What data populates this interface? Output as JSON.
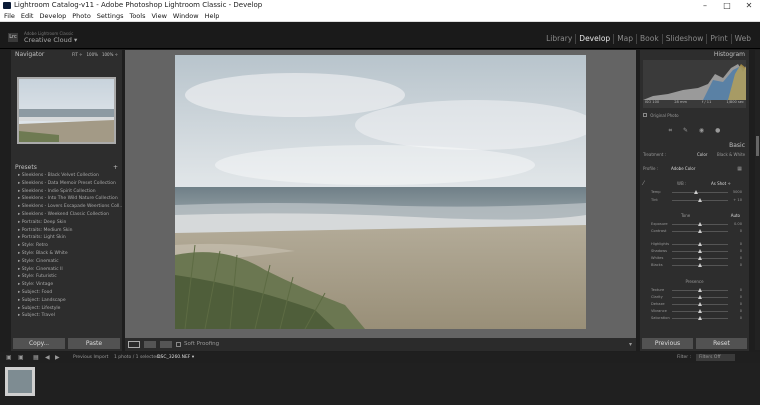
{
  "window": {
    "title": "Lightroom Catalog-v11 - Adobe Photoshop Lightroom Classic - Develop"
  },
  "menu": [
    "File",
    "Edit",
    "Develop",
    "Photo",
    "Settings",
    "Tools",
    "View",
    "Window",
    "Help"
  ],
  "identity": {
    "badge": "Lrc",
    "small": "Adobe Lightroom Classic",
    "big": "Creative Cloud",
    "arrow": "▾"
  },
  "modules": [
    "Library",
    "Develop",
    "Map",
    "Book",
    "Slideshow",
    "Print",
    "Web"
  ],
  "navigator": {
    "title": "Navigator",
    "zoom": [
      "FIT ÷",
      "100%",
      "100% ÷"
    ]
  },
  "presets": {
    "title": "Presets",
    "groups1": [
      "Sleeklens - Black Velvet Collection",
      "Sleeklens - Data Memoir Preset Collection",
      "Sleeklens - Indie Spirit Collection",
      "Sleeklens - Into The Wild Nature Collection",
      "Sleeklens - Lovers Escapade Weertions Coll..",
      "Sleeklens - Weekend Classic Collection"
    ],
    "groups2": [
      "Portraits: Deep Skin",
      "Portraits: Medium Skin",
      "Portraits: Light Skin",
      "Style: Retro",
      "Style: Black & White",
      "Style: Cinematic",
      "Style: Cinematic II",
      "Style: Futuristic",
      "Style: Vintage",
      "Subject: Food",
      "Subject: Landscape",
      "Subject: Lifestyle",
      "Subject: Travel"
    ]
  },
  "left_buttons": {
    "copy": "Copy...",
    "paste": "Paste"
  },
  "toolbar": {
    "soft_proofing": "Soft Proofing"
  },
  "histogram": {
    "title": "Histogram",
    "iso": "ISO 100",
    "focal": "28 mm",
    "aperture": "f / 11",
    "shutter": "1/800 sec",
    "original": "Original Photo"
  },
  "basic": {
    "title": "Basic",
    "treatment_label": "Treatment :",
    "color": "Color",
    "bw": "Black & White",
    "profile_label": "Profile :",
    "profile_value": "Adobe Color",
    "wb_label": "WB :",
    "wb_value": "As Shot ÷",
    "tone_label": "Tone",
    "auto": "Auto",
    "presence": "Presence"
  },
  "sliders": [
    {
      "label": "Temp",
      "value": "5000",
      "pos": 0.42,
      "key": "temp"
    },
    {
      "label": "Tint",
      "value": "+ 10",
      "pos": 0.5,
      "key": "tint"
    },
    {
      "label": "Exposure",
      "value": "0.00",
      "pos": 0.5,
      "key": "exposure"
    },
    {
      "label": "Contrast",
      "value": "0",
      "pos": 0.5,
      "key": "contrast"
    },
    {
      "label": "Highlights",
      "value": "0",
      "pos": 0.5,
      "key": "highlights"
    },
    {
      "label": "Shadows",
      "value": "0",
      "pos": 0.5,
      "key": "shadows"
    },
    {
      "label": "Whites",
      "value": "0",
      "pos": 0.5,
      "key": "whites"
    },
    {
      "label": "Blacks",
      "value": "0",
      "pos": 0.5,
      "key": "blacks"
    },
    {
      "label": "Texture",
      "value": "0",
      "pos": 0.5,
      "key": "texture"
    },
    {
      "label": "Clarity",
      "value": "0",
      "pos": 0.5,
      "key": "clarity"
    },
    {
      "label": "Dehaze",
      "value": "0",
      "pos": 0.5,
      "key": "dehaze"
    },
    {
      "label": "Vibrance",
      "value": "0",
      "pos": 0.5,
      "key": "vibrance"
    },
    {
      "label": "Saturation",
      "value": "0",
      "pos": 0.5,
      "key": "saturation"
    }
  ],
  "right_buttons": {
    "previous": "Previous",
    "reset": "Reset"
  },
  "filmstrip": {
    "source": "Previous Import",
    "count": "1 photo / 1 selected /",
    "filename": "DSC_3260.NEF ▾",
    "filter_label": "Filter :",
    "filter_value": "Filters Off"
  }
}
